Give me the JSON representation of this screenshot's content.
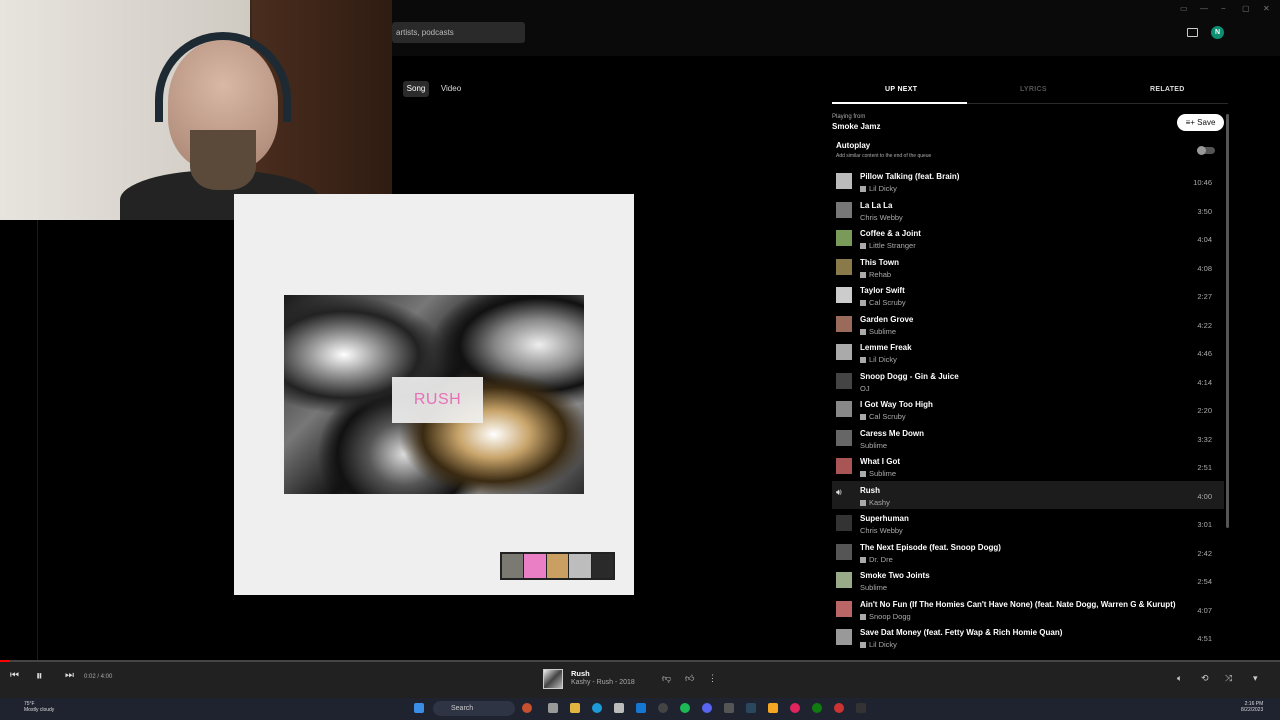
{
  "search": {
    "placeholder": "artists, podcasts"
  },
  "profile": {
    "initial": "N"
  },
  "view_toggle": {
    "song": "Song",
    "video": "Video"
  },
  "album_art": {
    "label": "RUSH",
    "palette": [
      "#7a7a72",
      "#ea7fc6",
      "#c9a062",
      "#bdbdbd",
      "#2a2a2a"
    ]
  },
  "tabs": {
    "up_next": "UP NEXT",
    "lyrics": "LYRICS",
    "related": "RELATED"
  },
  "queue_header": {
    "playing_from": "Playing from",
    "playlist": "Smoke Jamz",
    "save": "Save"
  },
  "autoplay": {
    "title": "Autoplay",
    "subtitle": "Add similar content to the end of the queue"
  },
  "queue": [
    {
      "title": "Pillow Talking (feat. Brain)",
      "artist": "Lil Dicky",
      "duration": "10:46",
      "explicit": true
    },
    {
      "title": "La La La",
      "artist": "Chris Webby",
      "duration": "3:50",
      "explicit": false
    },
    {
      "title": "Coffee & a Joint",
      "artist": "Little Stranger",
      "duration": "4:04",
      "explicit": true
    },
    {
      "title": "This Town",
      "artist": "Rehab",
      "duration": "4:08",
      "explicit": true
    },
    {
      "title": "Taylor Swift",
      "artist": "Cal Scruby",
      "duration": "2:27",
      "explicit": true
    },
    {
      "title": "Garden Grove",
      "artist": "Sublime",
      "duration": "4:22",
      "explicit": true
    },
    {
      "title": "Lemme Freak",
      "artist": "Lil Dicky",
      "duration": "4:46",
      "explicit": true
    },
    {
      "title": "Snoop Dogg - Gin & Juice",
      "artist": "OJ",
      "duration": "4:14",
      "explicit": false
    },
    {
      "title": "I Got Way Too High",
      "artist": "Cal Scruby",
      "duration": "2:20",
      "explicit": true
    },
    {
      "title": "Caress Me Down",
      "artist": "Sublime",
      "duration": "3:32",
      "explicit": false
    },
    {
      "title": "What I Got",
      "artist": "Sublime",
      "duration": "2:51",
      "explicit": true
    },
    {
      "title": "Rush",
      "artist": "Kashy",
      "duration": "4:00",
      "explicit": true,
      "active": true
    },
    {
      "title": "Superhuman",
      "artist": "Chris Webby",
      "duration": "3:01",
      "explicit": false
    },
    {
      "title": "The Next Episode (feat. Snoop Dogg)",
      "artist": "Dr. Dre",
      "duration": "2:42",
      "explicit": true
    },
    {
      "title": "Smoke Two Joints",
      "artist": "Sublime",
      "duration": "2:54",
      "explicit": false
    },
    {
      "title": "Ain't No Fun (If The Homies Can't Have None) (feat. Nate Dogg, Warren G & Kurupt)",
      "artist": "Snoop Dogg",
      "duration": "4:07",
      "explicit": true
    },
    {
      "title": "Save Dat Money (feat. Fetty Wap & Rich Homie Quan)",
      "artist": "Lil Dicky",
      "duration": "4:51",
      "explicit": true
    }
  ],
  "player": {
    "time": "0:02 / 4:00",
    "progress_fraction": 0.008,
    "now_playing_title": "Rush",
    "now_playing_sub": "Kashy - Rush - 2018"
  },
  "taskbar": {
    "search": "Search",
    "weather_temp": "75°F",
    "weather_desc": "Mostly cloudy",
    "time": "2:16 PM",
    "date": "8/22/2023"
  }
}
